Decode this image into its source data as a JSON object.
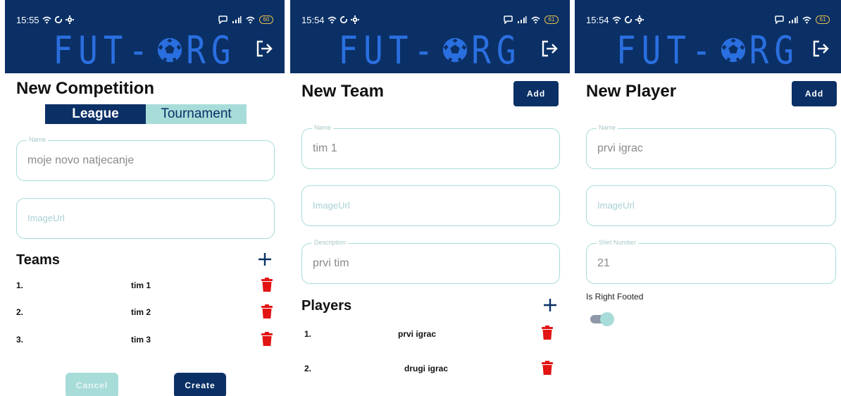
{
  "colors": {
    "navy": "#0b3066",
    "teal": "#a8dcd9",
    "logo_blue": "#2a6fe0",
    "trash_red": "#e21414",
    "battery": "#e8c24a"
  },
  "panels": [
    {
      "status": {
        "time": "15:55",
        "icons_left": [
          "wifi-icon",
          "sync-icon",
          "settings-icon"
        ],
        "battery": "60"
      },
      "logo": {
        "left": "FUT-",
        "right": "RG"
      },
      "title": "New Competition",
      "segments": {
        "active": "League",
        "inactive": "Tournament"
      },
      "fields": [
        {
          "label": "Name",
          "value": "moje novo natjecanje"
        },
        {
          "placeholder": "ImageUrl"
        }
      ],
      "list_title": "Teams",
      "items": [
        {
          "num": "1.",
          "name": "tim 1"
        },
        {
          "num": "2.",
          "name": "tim 2"
        },
        {
          "num": "3.",
          "name": "tim 3"
        }
      ],
      "cancel": "Cancel",
      "create": "Create"
    },
    {
      "status": {
        "time": "15:54",
        "icons_left": [
          "wifi-icon",
          "sync-icon",
          "settings-icon"
        ],
        "battery": "61"
      },
      "logo": {
        "left": "FUT-",
        "right": "RG"
      },
      "title": "New Team",
      "add": "Add",
      "fields": [
        {
          "label": "Name",
          "value": "tim 1"
        },
        {
          "placeholder": "ImageUrl"
        },
        {
          "label": "Description",
          "value": "prvi tim"
        }
      ],
      "list_title": "Players",
      "items": [
        {
          "num": "1.",
          "name": "prvi igrac"
        },
        {
          "num": "2.",
          "name": "drugi igrac"
        }
      ]
    },
    {
      "status": {
        "time": "15:54",
        "icons_left": [
          "wifi-icon",
          "sync-icon",
          "settings-icon"
        ],
        "battery": "61"
      },
      "logo": {
        "left": "FUT-",
        "right": "RG"
      },
      "title": "New Player",
      "add": "Add",
      "fields": [
        {
          "label": "Name",
          "value": "prvi igrac"
        },
        {
          "placeholder": "ImageUrl"
        },
        {
          "label": "Shirt Number",
          "value": "21"
        }
      ],
      "switch_label": "Is Right Footed",
      "switch_on": true
    }
  ]
}
